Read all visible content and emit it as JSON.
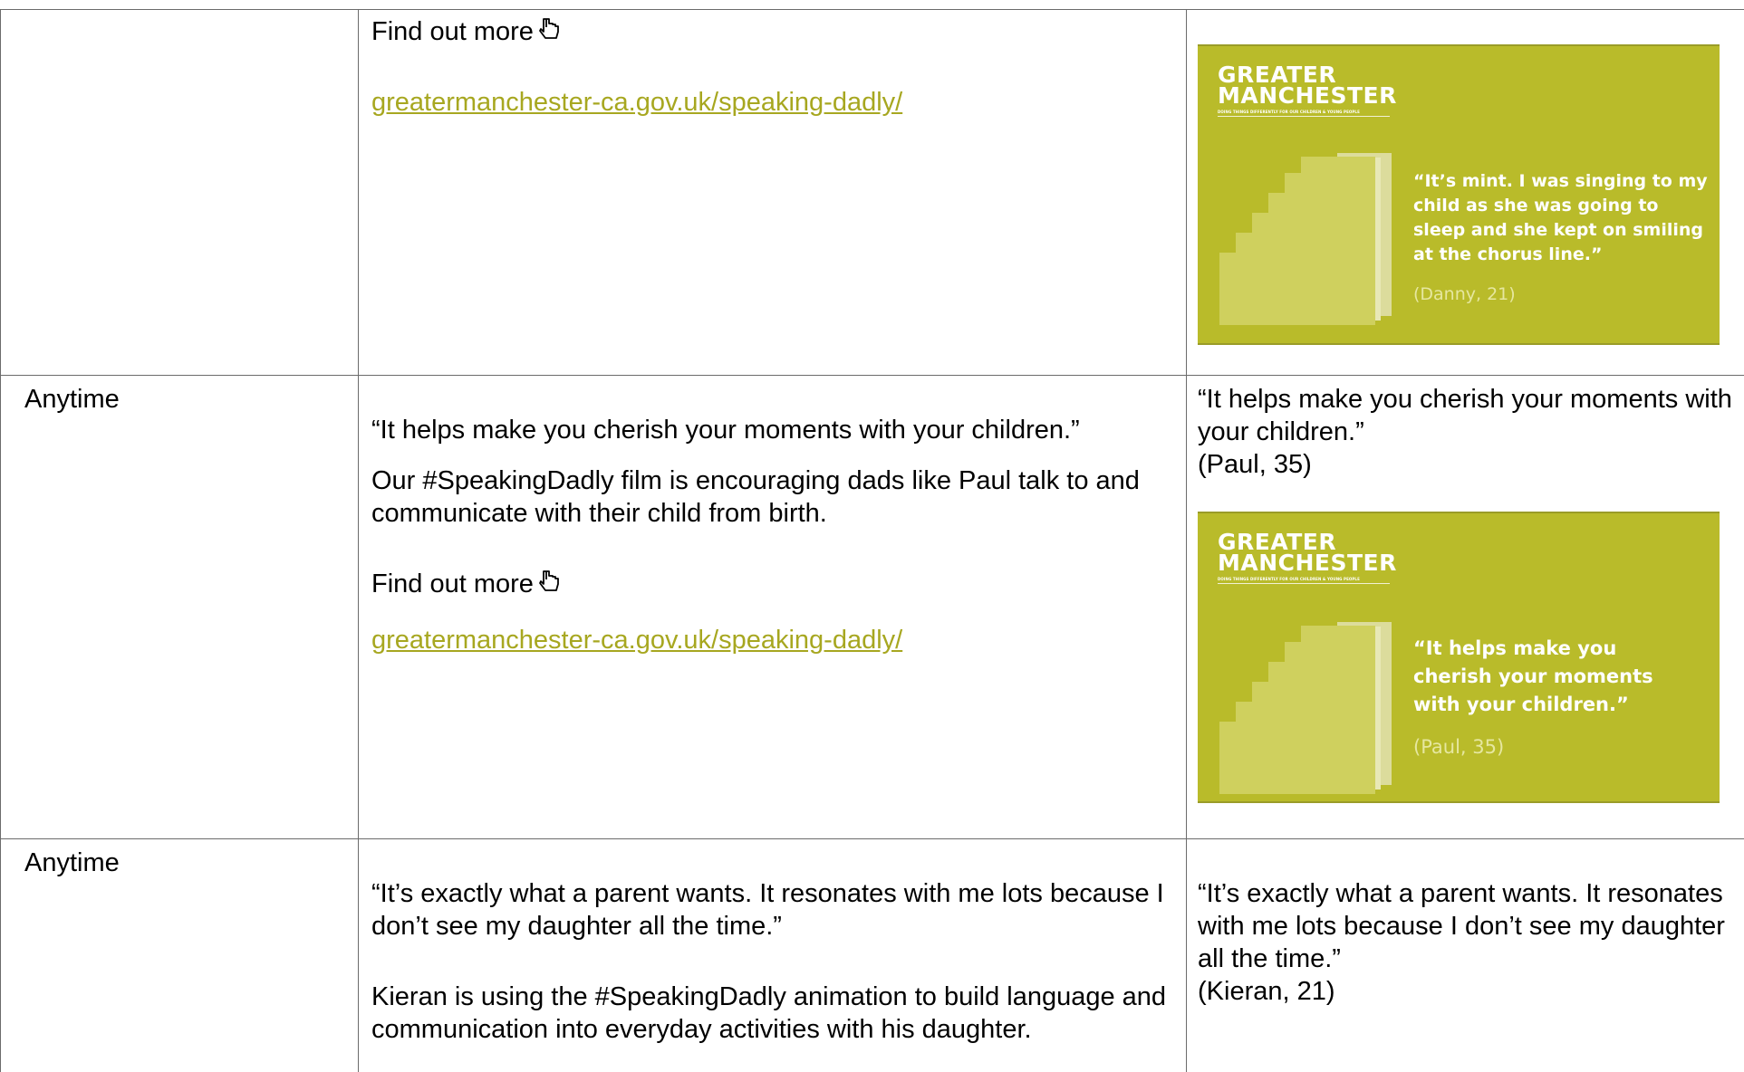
{
  "colors": {
    "link": "#a7a720",
    "card_bg": "#b9bb2a",
    "attribution": "#e6e7a0",
    "border": "#6b6b6b"
  },
  "card_logo": {
    "line1": "GREATER",
    "line2": "MANCHESTER",
    "tagline": "DOING THINGS DIFFERENTLY FOR OUR CHILDREN & YOUNG PEOPLE"
  },
  "rows": [
    {
      "when": "",
      "find_out_more": "Find out more",
      "link": "greatermanchester-ca.gov.uk/speaking-dadly/",
      "card": {
        "quote_lines": [
          "“It’s mint. I was singing to my",
          "child as she was going to",
          "sleep and she kept on smiling",
          "at the chorus line.”"
        ],
        "attribution": "(Danny, 21)"
      }
    },
    {
      "when": "Anytime",
      "quote": "“It helps make you cherish your moments with your children.”",
      "body": "Our #SpeakingDadly film is encouraging dads like Paul talk to and communicate with their child from birth.",
      "find_out_more": "Find out more",
      "link": "greatermanchester-ca.gov.uk/speaking-dadly/",
      "caption": "“It helps make you cherish your moments with your children.”",
      "caption_attribution": "(Paul, 35)",
      "card": {
        "quote_lines": [
          "“It helps make you",
          "cherish your moments",
          "with your children.”"
        ],
        "attribution": "(Paul, 35)"
      }
    },
    {
      "when": "Anytime",
      "quote": "“It’s exactly what a parent wants. It resonates with me lots because I don’t see my daughter all the time.”",
      "body": "Kieran is using the #SpeakingDadly animation to build language and communication into everyday activities with his daughter.",
      "caption": "“It’s exactly what a parent wants. It resonates with me lots because I don’t see my daughter all the time.”",
      "caption_attribution": "(Kieran, 21)"
    }
  ]
}
